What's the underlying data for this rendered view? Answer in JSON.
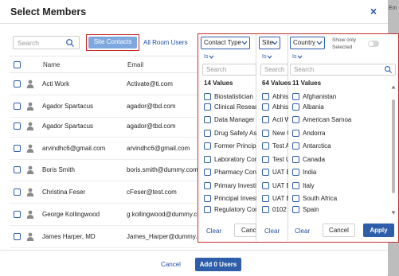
{
  "backdrop": {
    "edge_text": "Em"
  },
  "modal": {
    "title": "Select Members",
    "close_glyph": "×"
  },
  "toolbar": {
    "search_placeholder": "Search",
    "tab_site_contacts": "Site Contacts",
    "tab_all_room_users": "All Room Users"
  },
  "table": {
    "headers": {
      "name": "Name",
      "email": "Email"
    },
    "rows": [
      {
        "name": "Acti Work",
        "email": "Activate@ti.com"
      },
      {
        "name": "Agador Spartacus",
        "email": "agador@tbd.com"
      },
      {
        "name": "Agador Spartacus",
        "email": "agador@tbd.com"
      },
      {
        "name": "arvindhc6@gmail.com",
        "email": "arvindhc6@gmail.com"
      },
      {
        "name": "Boris Smith",
        "email": "boris.smith@dummy.com"
      },
      {
        "name": "Christina Feser",
        "email": "cFeser@test.com"
      },
      {
        "name": "George Kollingwood",
        "email": "g.kollingwood@dummy.com"
      },
      {
        "name": "James Harper, MD",
        "email": "James_Harper@dummy.com"
      }
    ]
  },
  "footer": {
    "cancel": "Cancel",
    "add": "Add 0 Users"
  },
  "filters": {
    "show_only_selected": "Show only Selected",
    "columns": [
      {
        "dropdown": "Contact Type",
        "is_label": "Is",
        "search_placeholder": "Search",
        "count": "14 Values",
        "items": [
          "Biostatistician",
          "Clinical Research",
          "Data Manager",
          "Drug Safety Associate",
          "Former Principal",
          "Laboratory Contact",
          "Pharmacy Contact",
          "Primary Investigator",
          "Principal Investigator",
          "Regulatory Contact"
        ],
        "clear": "Clear",
        "cancel": "Cancel"
      },
      {
        "dropdown": "Site",
        "is_label": "Is",
        "search_placeholder": "Search",
        "count": "64 Values",
        "items": [
          "Abhish",
          "Abhish",
          "Acti Wo",
          "New C",
          "Test A",
          "Test U",
          "UAT E",
          "UAT E",
          "UAT E",
          "0102 t"
        ],
        "clear": "Clear"
      },
      {
        "dropdown": "Country",
        "is_label": "Is",
        "search_placeholder": "Search",
        "count": "11 Values",
        "items": [
          "Afghanistan",
          "Albania",
          "American Samoa",
          "Andorra",
          "Antarctica",
          "Canada",
          "India",
          "Italy",
          "South Africa",
          "Spain"
        ],
        "clear": "Clear",
        "cancel": "Cancel",
        "apply": "Apply"
      }
    ]
  },
  "colors": {
    "accent": "#2e5da9",
    "highlight_border": "#c92b2b",
    "active_tab": "#7fa9de"
  }
}
